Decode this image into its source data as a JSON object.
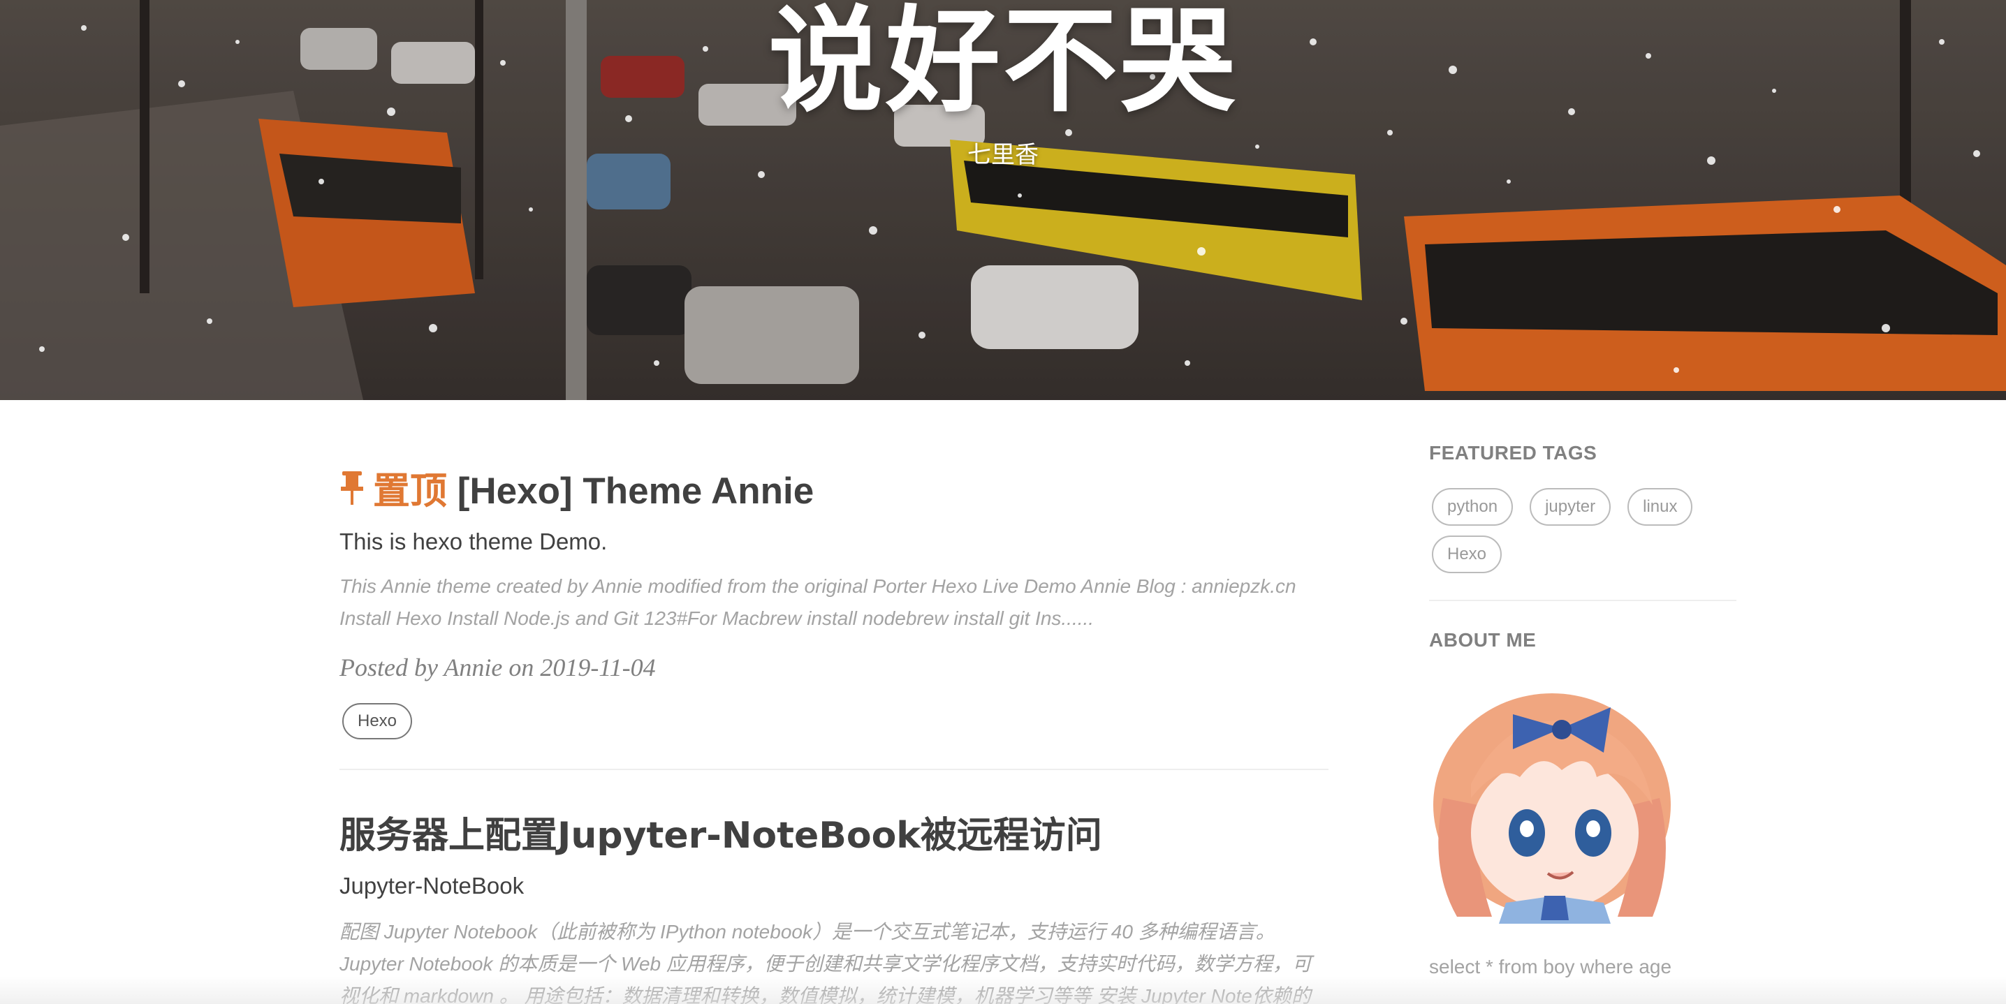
{
  "header": {
    "title": "说好不哭",
    "subtitle": "七里香"
  },
  "posts": [
    {
      "pin_label": "置顶",
      "title": "[Hexo] Theme Annie",
      "subtitle": "This is hexo theme Demo.",
      "excerpt_lines": [
        "This Annie theme created by Annie modified from the original Porter Hexo Live Demo Annie Blog : anniepzk.cn",
        "Install Hexo Install Node.js and Git 123#For Macbrew install nodebrew install git Ins......"
      ],
      "meta": {
        "prefix": "Posted by",
        "author": "Annie",
        "on": "on",
        "date": "2019-11-04"
      },
      "tags": [
        "Hexo"
      ]
    },
    {
      "title": "服务器上配置Jupyter-NoteBook被远程访问",
      "subtitle": "Jupyter-NoteBook",
      "excerpt_lines": [
        "配图 Jupyter Notebook（此前被称为 IPython notebook）是一个交互式笔记本，支持运行 40 多种编程语言。",
        "Jupyter Notebook 的本质是一个 Web 应用程序，便于创建和共享文学化程序文档，支持实时代码，数学方程，可",
        "视化和 markdown 。 用途包括：数据清理和转换，数值模拟，统计建模，机器学习等等 安装 Jupyter Note依赖的"
      ]
    }
  ],
  "sidebar": {
    "featured_tags_heading": "FEATURED TAGS",
    "featured_tags": [
      "python",
      "jupyter",
      "linux",
      "Hexo"
    ],
    "about_heading": "ABOUT ME",
    "about_text": "select * from boy where age"
  },
  "colors": {
    "pin": "#e07833",
    "title": "#404040",
    "muted": "#a3a3a3"
  }
}
